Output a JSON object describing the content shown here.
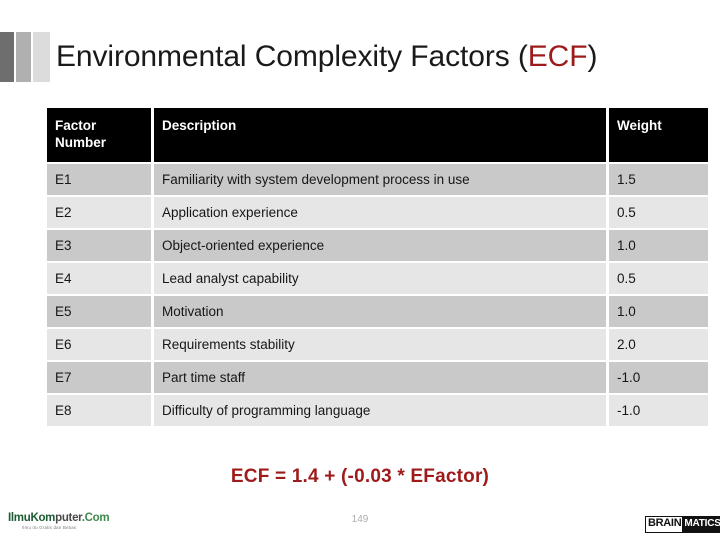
{
  "slide": {
    "title_main": "Environmental Complexity Factors (",
    "title_accent": "ECF",
    "title_tail": ")",
    "accent_color": "#9e1b1b",
    "header_bg": "#000000",
    "row_dark_color": "#c9c9c9",
    "row_light_color": "#e6e6e6"
  },
  "table": {
    "columns": [
      {
        "key": "factor_number",
        "label_line1": "Factor",
        "label_line2": "Number"
      },
      {
        "key": "description",
        "label_line1": "Description",
        "label_line2": ""
      },
      {
        "key": "weight",
        "label_line1": "Weight",
        "label_line2": ""
      }
    ],
    "rows": [
      {
        "factor_number": "E1",
        "description": "Familiarity with system development process in use",
        "weight": "1.5"
      },
      {
        "factor_number": "E2",
        "description": "Application experience",
        "weight": "0.5"
      },
      {
        "factor_number": "E3",
        "description": "Object-oriented experience",
        "weight": "1.0"
      },
      {
        "factor_number": "E4",
        "description": "Lead analyst capability",
        "weight": "0.5"
      },
      {
        "factor_number": "E5",
        "description": "Motivation",
        "weight": "1.0"
      },
      {
        "factor_number": "E6",
        "description": "Requirements stability",
        "weight": "2.0"
      },
      {
        "factor_number": "E7",
        "description": "Part time staff",
        "weight": "-1.0"
      },
      {
        "factor_number": "E8",
        "description": "Difficulty of programming language",
        "weight": "-1.0"
      }
    ]
  },
  "formula": {
    "text": "ECF = 1.4 + (-0.03 * EFactor)"
  },
  "footer": {
    "page_number": "149",
    "logo_left": {
      "part1": "Ilmu",
      "part2": "Kom",
      "part3": "puter",
      "part4": ".Com",
      "tagline": "Ilmu itu Gratis dan Bebas"
    },
    "logo_right": {
      "part1": "BRAIN",
      "part2": "MATICS"
    }
  }
}
